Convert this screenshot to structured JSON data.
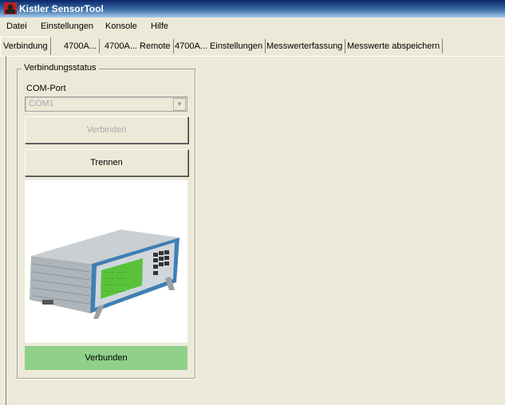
{
  "window": {
    "title": "Kistler SensorTool"
  },
  "menu": [
    "Datei",
    "Einstellungen",
    "Konsole",
    "Hilfe"
  ],
  "tabs": [
    {
      "label": "Verbindung",
      "active": true
    },
    {
      "label": "4700A..."
    },
    {
      "label": "4700A... Remote"
    },
    {
      "label": "4700A... Einstellungen"
    },
    {
      "label": "Messwerterfassung"
    },
    {
      "label": "Messwerte abspeichern"
    }
  ],
  "connection": {
    "group_label": "Verbindungsstatus",
    "port_label": "COM-Port",
    "port_value": "COM1",
    "connect_label": "Verbinden",
    "disconnect_label": "Trennen",
    "status_text": "Verbunden",
    "status_color": "#8fd08b"
  },
  "device_photo": {
    "subject": "Kistler 4700A measuring amplifier"
  }
}
